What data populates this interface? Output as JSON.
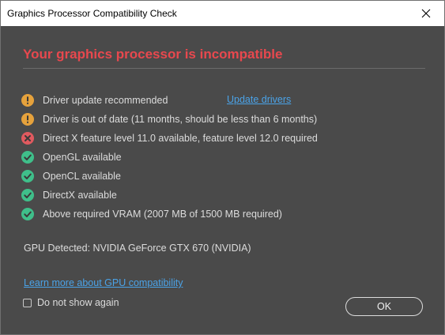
{
  "window": {
    "title": "Graphics Processor Compatibility Check"
  },
  "headline": "Your graphics processor is incompatible",
  "colors": {
    "headline": "#e8484e",
    "warning": "#e6a23c",
    "error": "#e05a5f",
    "success": "#3fbf8a",
    "link": "#4aa3e8",
    "background": "#4a4a4a"
  },
  "checks": [
    {
      "status": "warning",
      "icon": "warning-icon",
      "label": "Driver update recommended"
    },
    {
      "status": "warning",
      "icon": "warning-icon",
      "label": "Driver is out of date (11 months, should be less than 6 months)"
    },
    {
      "status": "error",
      "icon": "error-icon",
      "label": "Direct X feature level 11.0 available, feature level 12.0 required"
    },
    {
      "status": "success",
      "icon": "check-icon",
      "label": "OpenGL available"
    },
    {
      "status": "success",
      "icon": "check-icon",
      "label": "OpenCL available"
    },
    {
      "status": "success",
      "icon": "check-icon",
      "label": "DirectX available"
    },
    {
      "status": "success",
      "icon": "check-icon",
      "label": "Above required VRAM (2007 MB of 1500 MB required)"
    }
  ],
  "update_drivers_link": "Update drivers",
  "gpu_detected": "GPU Detected: NVIDIA GeForce GTX 670 (NVIDIA)",
  "learn_more_link": "Learn more about GPU compatibility",
  "dont_show_again": {
    "label": "Do not show again",
    "checked": false
  },
  "ok_button": "OK"
}
